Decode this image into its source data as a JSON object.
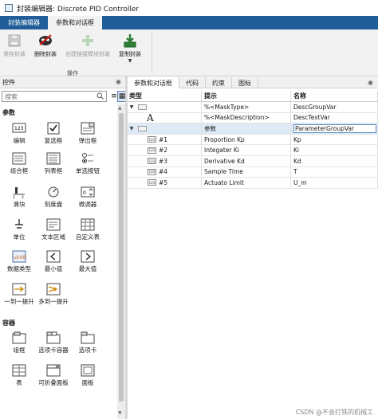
{
  "window": {
    "title": "封装编辑器: Discrete PID Controller"
  },
  "ribbon_tabs": [
    {
      "label": "封装编辑器",
      "active": false
    },
    {
      "label": "参数和对话框",
      "active": true
    }
  ],
  "toolstrip": {
    "buttons": [
      {
        "label": "保存封装",
        "enabled": false
      },
      {
        "label": "删除封装",
        "enabled": true
      },
      {
        "label": "创建链接模块封装",
        "enabled": false
      },
      {
        "label": "复制封装",
        "enabled": true
      }
    ],
    "group_label": "操作"
  },
  "controls_panel": {
    "title": "控件",
    "search_placeholder": "搜索",
    "sections": [
      {
        "title": "参数",
        "items": [
          "编辑",
          "复选框",
          "弹出框",
          "组合框",
          "列表框",
          "单选按钮",
          "滑块",
          "刻度盘",
          "微调器",
          "单位",
          "文本区域",
          "自定义表",
          "数据类型",
          "最小值",
          "最大值",
          "一到一提升",
          "多到一提升"
        ]
      },
      {
        "title": "容器",
        "items": [
          "组框",
          "选项卡容器",
          "选项卡",
          "表",
          "可折叠面板",
          "面板"
        ]
      }
    ]
  },
  "editor_tabs": [
    {
      "label": "参数和对话框",
      "active": true
    },
    {
      "label": "代码"
    },
    {
      "label": "约束"
    },
    {
      "label": "图标"
    }
  ],
  "table": {
    "headers": [
      "类型",
      "提示",
      "名称"
    ],
    "rows": [
      {
        "kind": "group",
        "num": "",
        "prompt": "%<MaskType>",
        "name": "DescGroupVar",
        "selected": false,
        "indent": 0
      },
      {
        "kind": "text",
        "num": "",
        "prompt": "%<MaskDescription>",
        "name": "DescTextVar",
        "selected": false,
        "indent": 1
      },
      {
        "kind": "group",
        "num": "",
        "prompt": "参数",
        "name": "ParameterGroupVar",
        "selected": true,
        "indent": 0
      },
      {
        "kind": "edit",
        "num": "#1",
        "prompt": "Proportion Kp",
        "name": "Kp",
        "selected": false,
        "indent": 1
      },
      {
        "kind": "edit",
        "num": "#2",
        "prompt": "Integater Ki",
        "name": "Ki",
        "selected": false,
        "indent": 1
      },
      {
        "kind": "edit",
        "num": "#3",
        "prompt": "Derivative Kd",
        "name": "Kd",
        "selected": false,
        "indent": 1
      },
      {
        "kind": "edit",
        "num": "#4",
        "prompt": "Sample Time",
        "name": "T",
        "selected": false,
        "indent": 1
      },
      {
        "kind": "edit",
        "num": "#5",
        "prompt": "Actuato Limit",
        "name": "U_m",
        "selected": false,
        "indent": 1
      }
    ]
  },
  "watermark": "CSDN @不会打铁的机械工"
}
